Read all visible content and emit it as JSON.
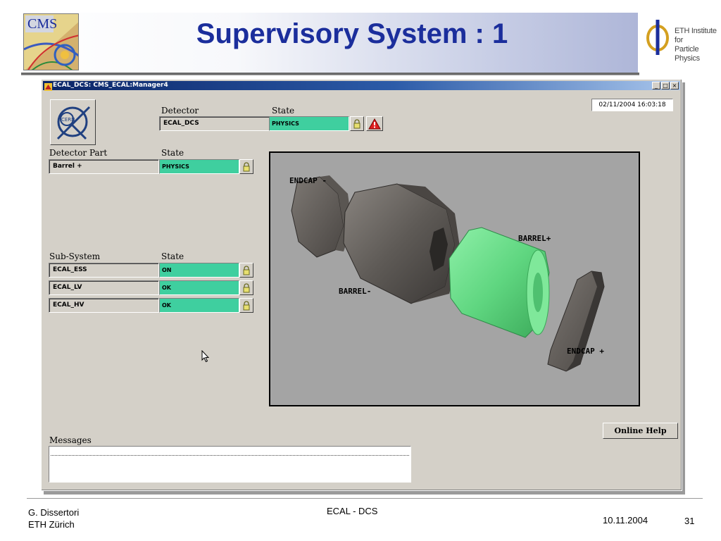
{
  "slide": {
    "title": "Supervisory System : 1",
    "cms_logo_text": "CMS",
    "eth_logo_line1": "ETH Institute for",
    "eth_logo_line2": "Particle Physics"
  },
  "window": {
    "title": "ECAL_DCS: CMS_ECAL:Manager4",
    "min_glyph": "_",
    "max_glyph": "□",
    "close_glyph": "×",
    "datetime": "02/11/2004  16:03:18"
  },
  "detector": {
    "header_label": "Detector",
    "state_header": "State",
    "name": "ECAL_DCS",
    "state": "PHYSICS"
  },
  "detector_part": {
    "header_label": "Detector Part",
    "state_header": "State",
    "name": "Barrel +",
    "state": "PHYSICS"
  },
  "sub_system": {
    "header_label": "Sub-System",
    "state_header": "State",
    "rows": [
      {
        "name": "ECAL_ESS",
        "state": "ON"
      },
      {
        "name": "ECAL_LV",
        "state": "OK"
      },
      {
        "name": "ECAL_HV",
        "state": "OK"
      }
    ]
  },
  "visualization": {
    "labels": {
      "endcap_minus": "ENDCAP -",
      "barrel_plus": "BARREL+",
      "barrel_minus": "BARREL-",
      "endcap_plus": "ENDCAP +"
    },
    "colors": {
      "active": "#66d98a",
      "inactive": "#6e6a66",
      "background": "#a4a4a4"
    }
  },
  "buttons": {
    "online_help": "Online Help"
  },
  "messages": {
    "label": "Messages"
  },
  "footer": {
    "author": "G. Dissertori",
    "institution": "ETH Zürich",
    "center": "ECAL - DCS",
    "date": "10.11.2004",
    "page": "31"
  },
  "colors": {
    "state_ok": "#3fcf9f",
    "title": "#1b2e9c",
    "window_bg": "#d4d0c8"
  }
}
